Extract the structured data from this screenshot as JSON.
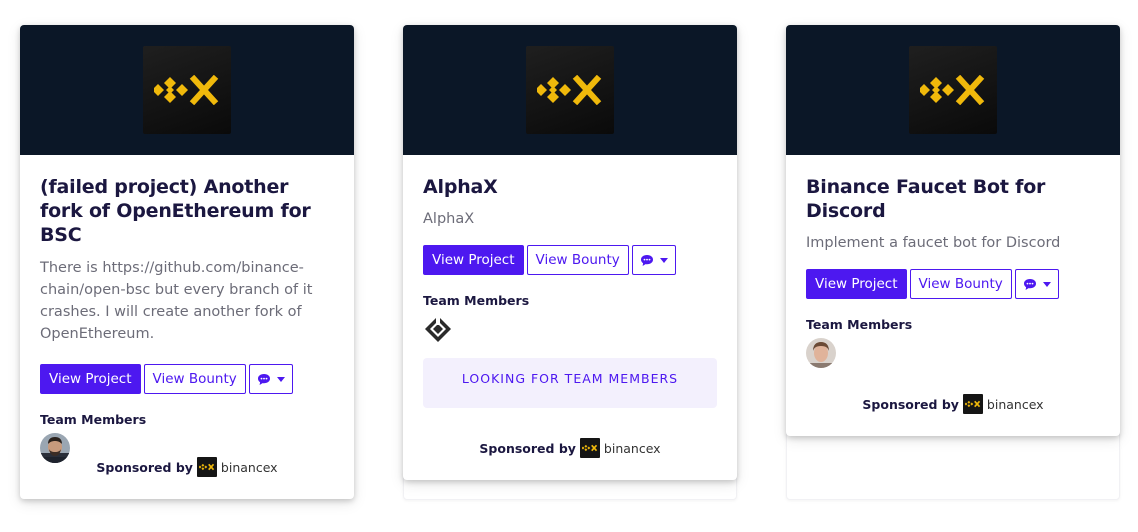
{
  "cards": [
    {
      "title": "(failed project) Another fork of OpenEthereum for BSC",
      "description": "There is https://github.com/binance-chain/open-bsc but every branch of it crashes. I will create another fork of OpenEthereum.",
      "view_project_label": "View Project",
      "view_bounty_label": "View Bounty",
      "team_members_label": "Team Members",
      "avatar_icon": "user-avatar-dark-hair",
      "sponsored_by_label": "Sponsored by",
      "sponsor_name": "binancex"
    },
    {
      "title": "AlphaX",
      "description": "AlphaX",
      "view_project_label": "View Project",
      "view_bounty_label": "View Bounty",
      "team_members_label": "Team Members",
      "avatar_icon": "diamond-logo-avatar",
      "looking_label": "LOOKING FOR TEAM MEMBERS",
      "sponsored_by_label": "Sponsored by",
      "sponsor_name": "binancex"
    },
    {
      "title": "Binance Faucet Bot for Discord",
      "description": "Implement a faucet bot for Discord",
      "view_project_label": "View Project",
      "view_bounty_label": "View Bounty",
      "team_members_label": "Team Members",
      "avatar_icon": "user-avatar-light",
      "sponsored_by_label": "Sponsored by",
      "sponsor_name": "binancex"
    }
  ],
  "colors": {
    "accent": "#4d18f0",
    "banner": "#0b1727",
    "logo_gold": "#f0b90b"
  }
}
